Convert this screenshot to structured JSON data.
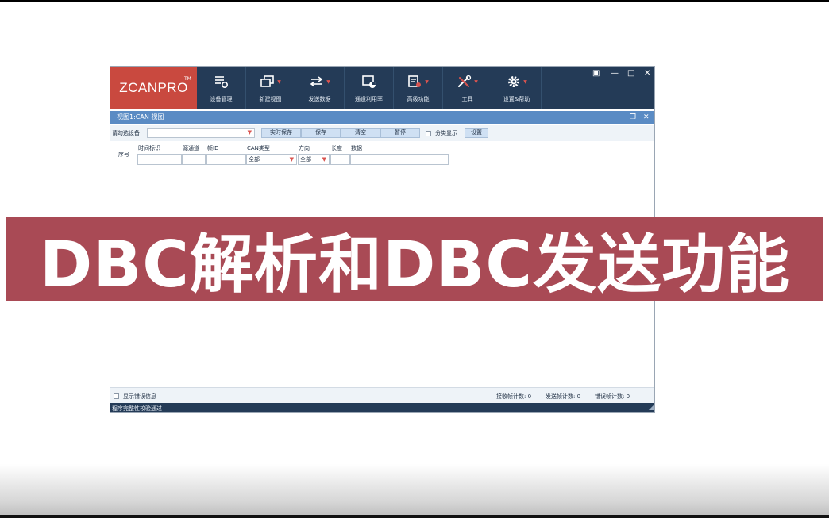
{
  "app": {
    "logo": "ZCANPRO",
    "logo_tm": "TM",
    "ribbon": [
      {
        "label": "设备管理",
        "icon": "device-list-gear-icon",
        "dropdown": false
      },
      {
        "label": "新建视图",
        "icon": "new-view-icon",
        "dropdown": true
      },
      {
        "label": "发送数据",
        "icon": "send-arrows-icon",
        "dropdown": true
      },
      {
        "label": "通道利用率",
        "icon": "channel-usage-chart-icon",
        "dropdown": false
      },
      {
        "label": "高级功能",
        "icon": "advanced-function-icon",
        "dropdown": true
      },
      {
        "label": "工具",
        "icon": "tools-icon",
        "dropdown": true
      },
      {
        "label": "设置&帮助",
        "icon": "settings-gear-icon",
        "dropdown": true
      }
    ],
    "window_controls": {
      "layout": "▣",
      "minimize": "—",
      "maximize": "□",
      "close": "✕"
    }
  },
  "view": {
    "title": "视图1:CAN 视图",
    "float_icon": "❐",
    "close_icon": "✕"
  },
  "toolbar": {
    "device_label": "请勾选设备",
    "device_value": "",
    "realtime_save": "实时保存",
    "save": "保存",
    "clear": "清空",
    "pause": "暂停",
    "classify_label": "分类显示",
    "settings": "设置"
  },
  "filter": {
    "seq_label": "序号",
    "time_label": "时间标识",
    "channel_label": "源通道",
    "frame_id_label": "帧ID",
    "can_type_label": "CAN类型",
    "direction_label": "方向",
    "length_label": "长度",
    "data_label": "数据",
    "can_type_value": "全部",
    "direction_value": "全部"
  },
  "status": {
    "show_error_label": "显示错误信息",
    "recv_count": "接收帧计数: 0",
    "send_count": "发送帧计数: 0",
    "error_count": "错误帧计数: 0"
  },
  "bottom": {
    "message": "程序完整性校验通过"
  },
  "banner": {
    "text": "DBC解析和DBC发送功能"
  },
  "colors": {
    "ribbon": "#243b57",
    "logo": "#c9493f",
    "viewbar": "#5a8bc4",
    "banner": "#a94a55",
    "dropdown_accent": "#d9534f"
  }
}
